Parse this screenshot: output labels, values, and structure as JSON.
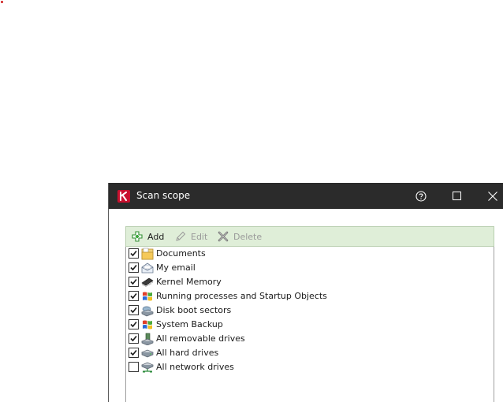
{
  "window": {
    "title": "Scan scope",
    "accent": "#c8102e",
    "titlebar_color": "#2b2b2b"
  },
  "toolbar": {
    "add_label": "Add",
    "edit_label": "Edit",
    "delete_label": "Delete",
    "background": "#dfeed8"
  },
  "scope_items": [
    {
      "label": "Documents",
      "checked": true,
      "icon": "folder-icon"
    },
    {
      "label": "My email",
      "checked": true,
      "icon": "mail-icon"
    },
    {
      "label": "Kernel Memory",
      "checked": true,
      "icon": "memory-chip-icon"
    },
    {
      "label": "Running processes and Startup Objects",
      "checked": true,
      "icon": "windows-flag-icon"
    },
    {
      "label": "Disk boot sectors",
      "checked": true,
      "icon": "disk-sector-icon"
    },
    {
      "label": "System Backup",
      "checked": true,
      "icon": "windows-flag-icon"
    },
    {
      "label": "All removable drives",
      "checked": true,
      "icon": "removable-drive-icon"
    },
    {
      "label": "All hard drives",
      "checked": true,
      "icon": "hard-drive-icon"
    },
    {
      "label": "All network drives",
      "checked": false,
      "icon": "network-drive-icon"
    }
  ]
}
